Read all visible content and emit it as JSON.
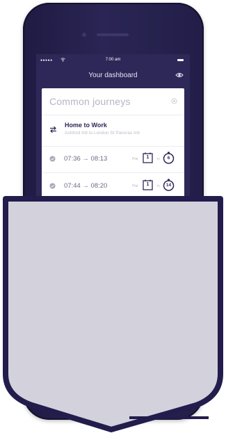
{
  "status_bar": {
    "signal": "●●●●●",
    "time": "7:00 am"
  },
  "nav": {
    "title": "Your dashboard",
    "eye_icon": "eye-icon"
  },
  "card": {
    "heading": "Common journeys",
    "gear_icon": "gear-icon"
  },
  "journey": {
    "name": "Home to Work",
    "route": "Ashford Intl to London St Pancras Intl",
    "icon": "swap-arrows-icon"
  },
  "trips": [
    {
      "depart_arrive": "07:36 → 08:13",
      "plat_label": "Plat",
      "platform": "1",
      "in_label": "in",
      "minutes": "6"
    },
    {
      "depart_arrive": "07:44 → 08:20",
      "plat_label": "Plat",
      "platform": "1",
      "in_label": "in",
      "minutes": "14"
    }
  ],
  "colors": {
    "brand_dark": "#2d2858",
    "shield_fill": "#d3d2dc",
    "shield_border": "#221d4c"
  }
}
